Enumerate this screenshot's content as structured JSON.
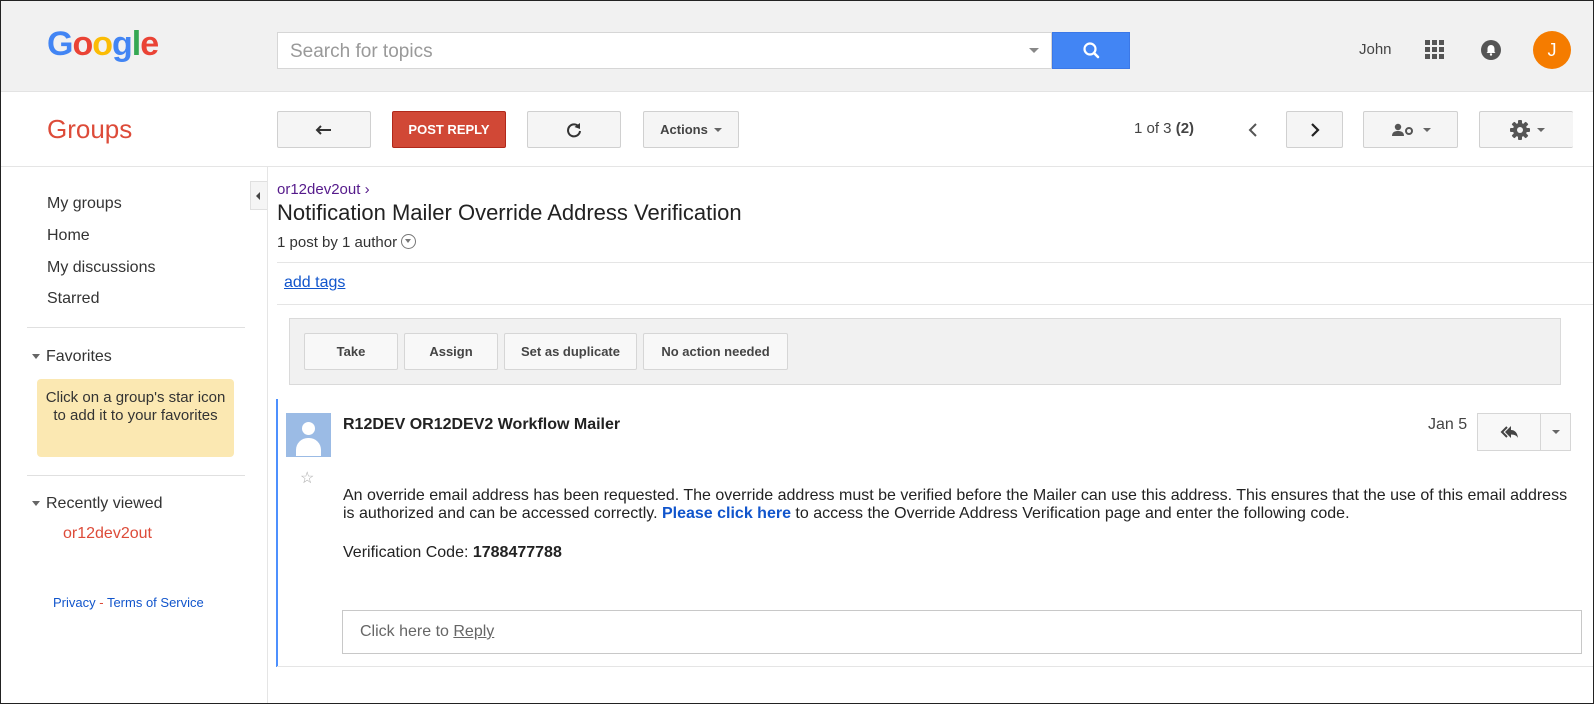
{
  "header": {
    "logo": [
      "G",
      "o",
      "o",
      "g",
      "l",
      "e"
    ],
    "logo_colors": [
      "#4285f4",
      "#ea4335",
      "#fbbc05",
      "#4285f4",
      "#34a853",
      "#ea4335"
    ],
    "search_placeholder": "Search for topics",
    "user_name": "John",
    "avatar_letter": "J"
  },
  "toolbar": {
    "app_title": "Groups",
    "post_reply_label": "POST REPLY",
    "actions_label": "Actions",
    "pager_prefix": "1 of 3",
    "pager_count": "(2)"
  },
  "sidebar": {
    "nav": [
      "My groups",
      "Home",
      "My discussions",
      "Starred"
    ],
    "favorites_title": "Favorites",
    "favorites_hint": "Click on a group's star icon to add it to your favorites",
    "recent_title": "Recently viewed",
    "recent_items": [
      "or12dev2out"
    ],
    "privacy_label": "Privacy",
    "footer_sep": " - ",
    "terms_label": "Terms of Service"
  },
  "topic": {
    "breadcrumb": "or12dev2out ›",
    "title": "Notification Mailer Override Address Verification",
    "meta": "1 post by 1 author",
    "add_tags": "add tags"
  },
  "actions": [
    "Take",
    "Assign",
    "Set as duplicate",
    "No action needed"
  ],
  "post": {
    "author": "R12DEV OR12DEV2 Workflow Mailer",
    "date": "Jan 5",
    "body_part1": "An override email address has been requested. The override address must be verified before the Mailer can use this address. This ensures that the use of this email address is authorized and can be accessed correctly. ",
    "body_link": "Please click here",
    "body_part2": " to access the Override Address Verification page and enter the following code.",
    "code_label": "Verification Code: ",
    "code_value": "1788477788",
    "reply_prefix": "Click here to ",
    "reply_link": "Reply"
  }
}
